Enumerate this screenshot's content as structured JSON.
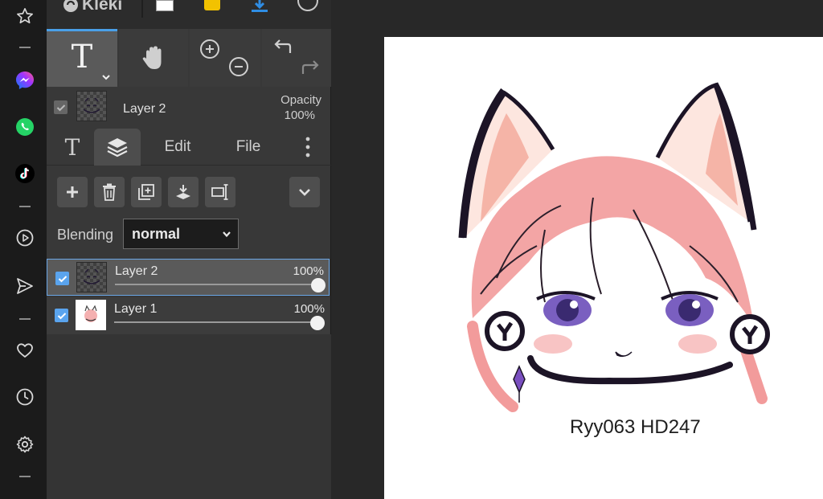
{
  "app": {
    "logo_text": "Kleki"
  },
  "browser_sidebar": {
    "icons": [
      "star-icon",
      "messenger-icon",
      "whatsapp-icon",
      "tiktok-icon",
      "play-icon",
      "send-icon",
      "heart-icon",
      "clock-icon",
      "settings-icon"
    ]
  },
  "tools": {
    "text_label": "T"
  },
  "layer_preview": {
    "name": "Layer 2",
    "opacity_label": "Opacity",
    "opacity_value": "100%"
  },
  "tabs": {
    "edit": "Edit",
    "file": "File"
  },
  "blending": {
    "label": "Blending",
    "value": "normal"
  },
  "layers": [
    {
      "name": "Layer 2",
      "opacity": "100%",
      "opacity_fraction": 1.0,
      "visible": true,
      "selected": true
    },
    {
      "name": "Layer 1",
      "opacity": "100%",
      "opacity_fraction": 1.0,
      "visible": true,
      "selected": false
    }
  ],
  "canvas": {
    "caption": "Ryy063 HD247"
  },
  "colors": {
    "accent_blue": "#4aa0e8",
    "panel_bg": "#383838",
    "canvas_bg": "#ffffff",
    "hair_pink": "#f29b9b"
  }
}
